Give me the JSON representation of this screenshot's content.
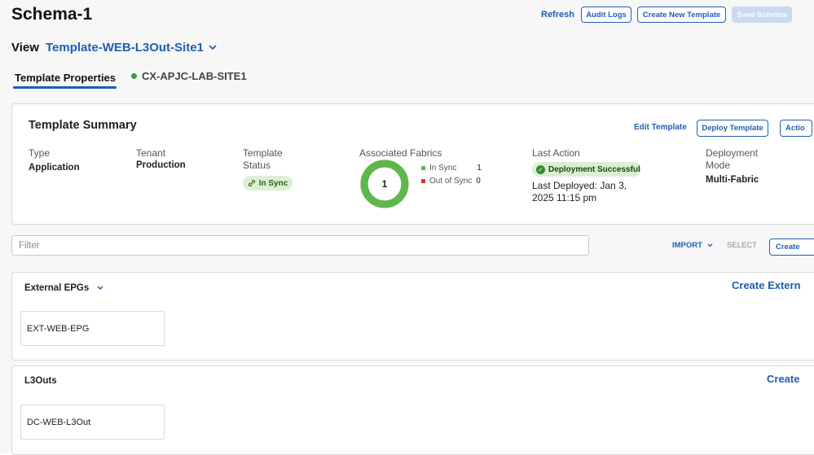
{
  "header": {
    "title": "Schema-1",
    "refresh_label": "Refresh",
    "audit_logs_label": "Audit Logs",
    "create_template_label": "Create New Template",
    "save_schema_label": "Save Schema"
  },
  "view": {
    "label": "View",
    "selected_template": "Template-WEB-L3Out-Site1",
    "chevron_icon": "chevron-down-icon"
  },
  "tabs": [
    {
      "label": "Template Properties",
      "active": true
    },
    {
      "label": "CX-APJC-LAB-SITE1",
      "active": false,
      "status_color": "#3d9c3a"
    }
  ],
  "summary": {
    "title": "Template Summary",
    "edit_label": "Edit Template",
    "deploy_label": "Deploy Template",
    "actions_label": "Actio",
    "type": {
      "label": "Type",
      "value": "Application"
    },
    "tenant": {
      "label": "Tenant",
      "value": "Production"
    },
    "template_status": {
      "label_line1": "Template",
      "label_line2": "Status",
      "badge": "In Sync",
      "icon": "link-icon"
    },
    "fabrics": {
      "label": "Associated Fabrics",
      "count": "1",
      "in_sync_label": "In Sync",
      "in_sync_count": "1",
      "out_of_sync_label": "Out of Sync",
      "out_of_sync_count": "0",
      "in_sync_fraction": 1.0,
      "in_sync_color": "#5cb84d",
      "out_of_sync_color": "#d9342b"
    },
    "last_action": {
      "label": "Last Action",
      "badge": "Deployment Successful",
      "badge_icon": "check-circle-icon",
      "deployed_line1": "Last Deployed: Jan 3,",
      "deployed_line2": "2025 11:15 pm"
    },
    "deployment_mode": {
      "label_line1": "Deployment",
      "label_line2": "Mode",
      "value": "Multi-Fabric"
    }
  },
  "toolbar": {
    "filter_placeholder": "Filter",
    "import_label": "IMPORT",
    "select_label": "SELECT",
    "create_label": "Create"
  },
  "external_epgs": {
    "title": "External EPGs",
    "create_label": "Create Extern",
    "items": [
      "EXT-WEB-EPG"
    ]
  },
  "l3outs": {
    "title": "L3Outs",
    "create_label": "Create",
    "items": [
      "DC-WEB-L3Out"
    ]
  },
  "colors": {
    "accent": "#1e5fb3",
    "success_bg": "#dcefd3",
    "success": "#2f8f2c"
  }
}
